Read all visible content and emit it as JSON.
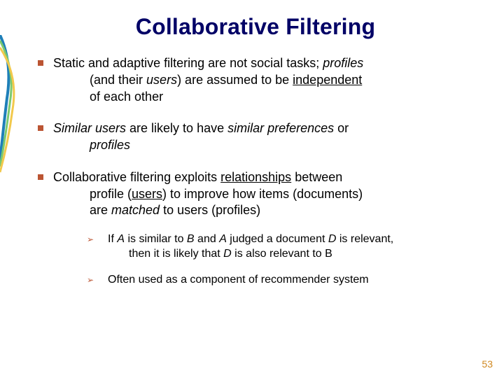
{
  "title": "Collaborative Filtering",
  "bullets": [
    {
      "p1a": "Static and adaptive filtering are not social tasks; ",
      "p1b_i": "profiles",
      "p2a": "(and their ",
      "p2b_i": "users",
      "p2c": ") are assumed to be ",
      "p2d_u": "independent",
      "p3": "of each other"
    },
    {
      "p1a_i": "Similar users",
      "p1b": " are likely to have ",
      "p1c_i": "similar preferences",
      "p1d": " or",
      "p2a_i": "profiles"
    },
    {
      "p1a": "Collaborative filtering exploits ",
      "p1b_u": "relationships",
      "p1c": " between",
      "p2a": "profile (",
      "p2b_u": "users",
      "p2c": ") to improve how items (documents)",
      "p3a": "are ",
      "p3b_i": "matched",
      "p3c": " to users (profiles)"
    }
  ],
  "sub": [
    {
      "p1a": "If ",
      "p1b_i": "A",
      "p1c": " is similar to ",
      "p1d_i": "B",
      "p1e": " and ",
      "p1f_i": "A",
      "p1g": " judged a document ",
      "p1h_i": "D",
      "p1i": " is relevant,",
      "p2a": "then it is likely that ",
      "p2b_i": "D",
      "p2c": " is also relevant to B"
    },
    {
      "p1": "Often used as a component of recommender system"
    }
  ],
  "pagenum": "53"
}
